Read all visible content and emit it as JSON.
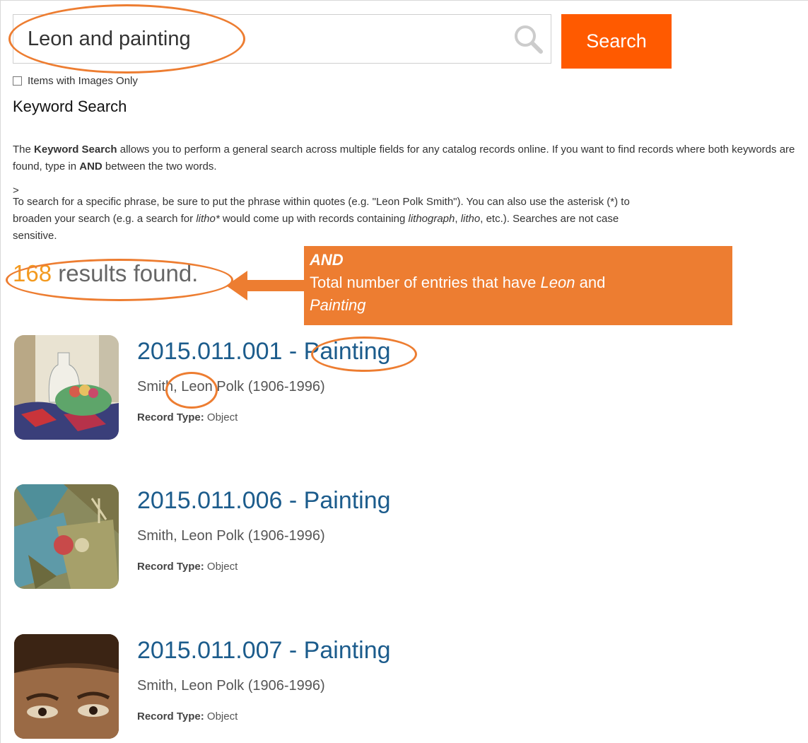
{
  "search": {
    "query": "Leon and painting",
    "button_label": "Search"
  },
  "filter": {
    "images_only_label": "Items with Images Only",
    "images_only_checked": false
  },
  "section": {
    "title": "Keyword Search"
  },
  "description": {
    "p1_pre": "The ",
    "p1_bold": "Keyword Search",
    "p1_post": " allows you to perform a general search across multiple fields for any catalog records online. If you want to find records where both keywords are found, type in ",
    "p1_bold2": "AND",
    "p1_end": " between the two words.",
    "gt": ">",
    "p2_a": "To search for a specific phrase, be sure to put the phrase within quotes (e.g. \"Leon Polk Smith\"). You can also use the asterisk (*) to",
    "p2_b": "broaden your search (e.g. a search for ",
    "p2_b_it1": "litho*",
    "p2_b_mid": " would come up with records containing ",
    "p2_b_it2": "lithograph",
    "p2_b_sep": ", ",
    "p2_b_it3": "litho",
    "p2_b_end": ", etc.). Searches are not case",
    "p2_c": "sensitive."
  },
  "results": {
    "count": "168",
    "label": " results found."
  },
  "callout": {
    "title": "AND",
    "text_pre": "Total number of entries that have ",
    "term1": "Leon",
    "text_mid": " and",
    "term2": "Painting"
  },
  "items": [
    {
      "title": "2015.011.001 - Painting",
      "artist": "Smith, Leon Polk (1906-1996)",
      "record_type_label": "Record Type:",
      "record_type": "Object"
    },
    {
      "title": "2015.011.006 - Painting",
      "artist": "Smith, Leon Polk (1906-1996)",
      "record_type_label": "Record Type:",
      "record_type": "Object"
    },
    {
      "title": "2015.011.007 - Painting",
      "artist": "Smith, Leon Polk (1906-1996)",
      "record_type_label": "Record Type:",
      "record_type": "Object"
    }
  ],
  "colors": {
    "search_button": "#ff5a00",
    "annotation_orange": "#ed7d31",
    "count_orange": "#f39a1f",
    "title_blue": "#1c5c8c"
  }
}
